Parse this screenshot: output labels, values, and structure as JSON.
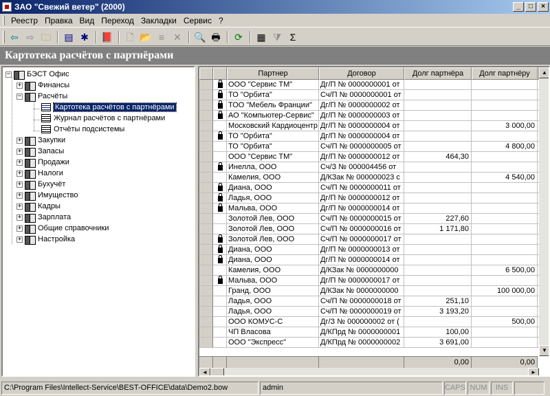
{
  "window": {
    "title": "ЗАО \"Свежий ветер\" (2000)",
    "btn_min": "_",
    "btn_max": "□",
    "btn_close": "×"
  },
  "menu": [
    "Реестр",
    "Правка",
    "Вид",
    "Переход",
    "Закладки",
    "Сервис",
    "?"
  ],
  "toolbar": {
    "back": "⇦",
    "forward": "⇨",
    "folder_up": "🗀",
    "panel1": "▤",
    "panel2": "✱",
    "book": "📕",
    "new": "🗋",
    "open": "📂",
    "stack": "≡",
    "delete": "✕",
    "preview": "🔍",
    "print": "🖶",
    "refresh": "⟳",
    "calc": "▦",
    "filter": "⧩",
    "sum": "Σ"
  },
  "header": {
    "title": "Картотека расчётов с партнёрами"
  },
  "tree": {
    "root": "БЭСТ Офис",
    "items": [
      {
        "label": "Финансы"
      },
      {
        "label": "Расчёты"
      },
      {
        "label": "Картотека расчётов с партнёрами"
      },
      {
        "label": "Журнал расчётов с партнёрами"
      },
      {
        "label": "Отчёты подсистемы"
      },
      {
        "label": "Закупки"
      },
      {
        "label": "Запасы"
      },
      {
        "label": "Продажи"
      },
      {
        "label": "Налоги"
      },
      {
        "label": "Бухучёт"
      },
      {
        "label": "Имущество"
      },
      {
        "label": "Кадры"
      },
      {
        "label": "Зарплата"
      },
      {
        "label": "Общие справочники"
      },
      {
        "label": "Настройка"
      }
    ],
    "expanded_sign": "−",
    "collapsed_sign": "+"
  },
  "grid": {
    "columns": [
      "Партнер",
      "Договор",
      "Долг партнёра",
      "Долг партнёру"
    ],
    "rows": [
      {
        "lock": true,
        "partner": "ООО \"Сервис ТМ\"",
        "contract": "Дг/П № 0000000001 от",
        "debt_from": "",
        "debt_to": ""
      },
      {
        "lock": true,
        "partner": "ТО \"Орбита\"",
        "contract": "Сч/П № 0000000001 от",
        "debt_from": "",
        "debt_to": ""
      },
      {
        "lock": true,
        "partner": "ТОО \"Мебель Франции\"",
        "contract": "Дг/П № 0000000002 от",
        "debt_from": "",
        "debt_to": ""
      },
      {
        "lock": true,
        "partner": "АО \"Компьютер-Сервис\"",
        "contract": "Дг/П № 0000000003 от",
        "debt_from": "",
        "debt_to": ""
      },
      {
        "lock": false,
        "partner": "Московский Кардиоцентр",
        "contract": "Дг/П № 0000000004 от",
        "debt_from": "",
        "debt_to": "3 000,00"
      },
      {
        "lock": true,
        "partner": "ТО \"Орбита\"",
        "contract": "Дг/П № 0000000004 от",
        "debt_from": "",
        "debt_to": ""
      },
      {
        "lock": false,
        "partner": "ТО \"Орбита\"",
        "contract": "Сч/П № 0000000005 от",
        "debt_from": "",
        "debt_to": "4 800,00"
      },
      {
        "lock": false,
        "partner": "ООО \"Сервис ТМ\"",
        "contract": "Дг/П № 0000000012 от",
        "debt_from": "464,30",
        "debt_to": ""
      },
      {
        "lock": true,
        "partner": "Инелла, ООО",
        "contract": "Сч/З № 000004456 от",
        "debt_from": "",
        "debt_to": ""
      },
      {
        "lock": false,
        "partner": "Камелия, ООО",
        "contract": "Д/КЗак № 000000023 с",
        "debt_from": "",
        "debt_to": "4 540,00"
      },
      {
        "lock": true,
        "partner": "Диана, ООО",
        "contract": "Сч/П № 0000000011 от",
        "debt_from": "",
        "debt_to": ""
      },
      {
        "lock": true,
        "partner": "Ладья, ООО",
        "contract": "Дг/П № 0000000012 от",
        "debt_from": "",
        "debt_to": ""
      },
      {
        "lock": true,
        "partner": "Мальва, ООО",
        "contract": "Дг/П № 0000000014 от",
        "debt_from": "",
        "debt_to": ""
      },
      {
        "lock": false,
        "partner": "Золотой Лев, ООО",
        "contract": "Сч/П № 0000000015 от",
        "debt_from": "227,60",
        "debt_to": ""
      },
      {
        "lock": false,
        "partner": "Золотой Лев, ООО",
        "contract": "Сч/П № 0000000016 от",
        "debt_from": "1 171,80",
        "debt_to": ""
      },
      {
        "lock": true,
        "partner": "Золотой Лев, ООО",
        "contract": "Сч/П № 0000000017 от",
        "debt_from": "",
        "debt_to": ""
      },
      {
        "lock": true,
        "partner": "Диана, ООО",
        "contract": "Дг/П № 0000000013 от",
        "debt_from": "",
        "debt_to": ""
      },
      {
        "lock": true,
        "partner": "Диана, ООО",
        "contract": "Дг/П № 0000000014 от",
        "debt_from": "",
        "debt_to": ""
      },
      {
        "lock": false,
        "partner": "Камелия, ООО",
        "contract": "Д/КЗак № 0000000000",
        "debt_from": "",
        "debt_to": "6 500,00"
      },
      {
        "lock": true,
        "partner": "Мальва, ООО",
        "contract": "Дг/П № 0000000017 от",
        "debt_from": "",
        "debt_to": ""
      },
      {
        "lock": false,
        "partner": "Гранд, ООО",
        "contract": "Д/КЗак № 0000000000",
        "debt_from": "",
        "debt_to": "100 000,00"
      },
      {
        "lock": false,
        "partner": "Ладья, ООО",
        "contract": "Сч/П № 0000000018 от",
        "debt_from": "251,10",
        "debt_to": ""
      },
      {
        "lock": false,
        "partner": "Ладья, ООО",
        "contract": "Сч/П № 0000000019 от",
        "debt_from": "3 193,20",
        "debt_to": ""
      },
      {
        "lock": false,
        "partner": "ООО КОМУС-С",
        "contract": "Дг/З № 000000002 от (",
        "debt_from": "",
        "debt_to": "500,00"
      },
      {
        "lock": false,
        "partner": "ЧП Власова",
        "contract": "Д/КПрд № 0000000001",
        "debt_from": "100,00",
        "debt_to": ""
      },
      {
        "lock": false,
        "partner": "ООО \"Экспресс\"",
        "contract": "Д/КПрд № 0000000002",
        "debt_from": "3 691,00",
        "debt_to": ""
      }
    ],
    "totals": {
      "debt_from": "0,00",
      "debt_to": "0,00"
    },
    "scroll_up": "▲",
    "scroll_down": "▼",
    "scroll_left": "◄",
    "scroll_right": "►"
  },
  "status": {
    "path": "C:\\Program Files\\Intellect-Service\\BEST-OFFICE\\data\\Demo2.bow",
    "user": "admin",
    "caps": "CAPS",
    "num": "NUM",
    "ins": "INS"
  }
}
